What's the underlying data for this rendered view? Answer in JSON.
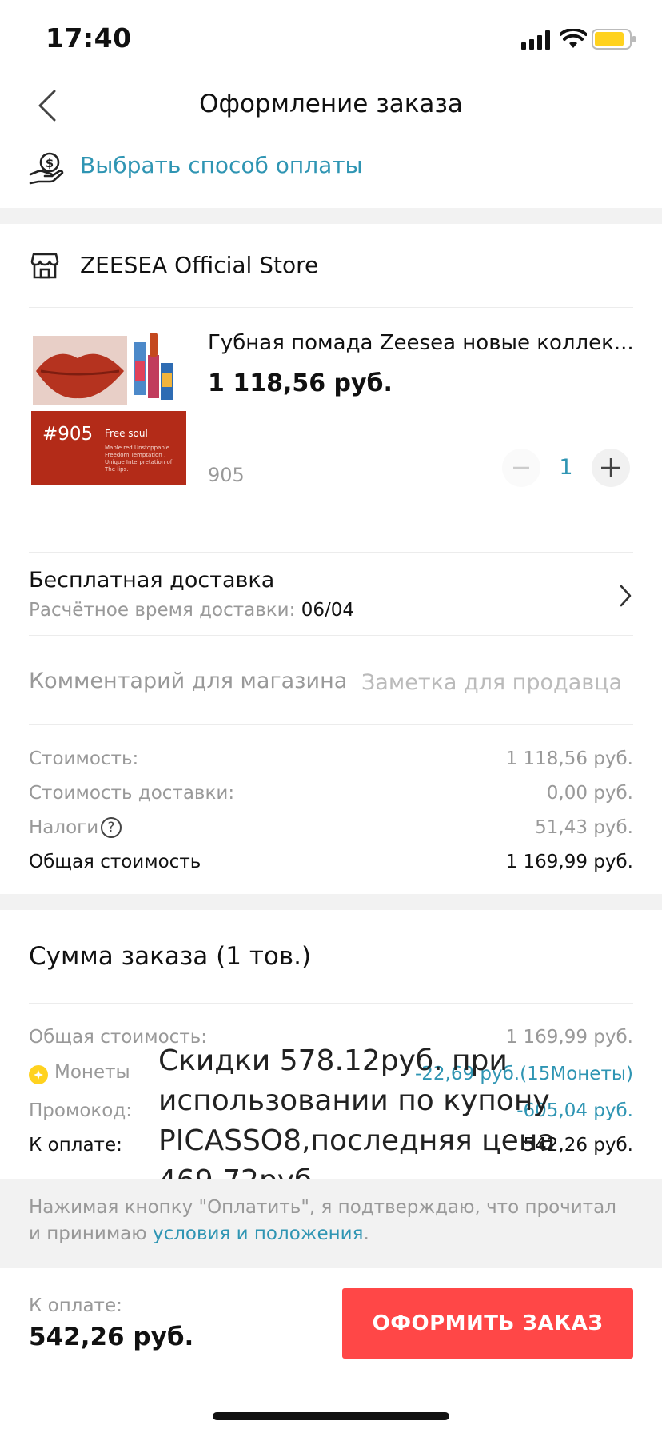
{
  "status_bar": {
    "time": "17:40"
  },
  "header": {
    "title": "Оформление заказа",
    "back_icon": "chevron-left-icon"
  },
  "payment": {
    "label": "Выбрать способ оплаты",
    "icon": "hand-coin-icon"
  },
  "store": {
    "name": "ZEESEA Official Store",
    "icon": "store-icon"
  },
  "product": {
    "title": "Губная помада Zeesea новые коллек...",
    "price": "1 118,56 руб.",
    "variant": "905",
    "quantity": "1",
    "image": {
      "shade_code": "#905",
      "shade_name": "Free soul",
      "description_lines": [
        "Maple red Unstoppable",
        "Freedom Temptation ,",
        "Unique Interpretation of",
        "The lips."
      ]
    }
  },
  "shipping": {
    "title": "Бесплатная доставка",
    "eta_label": "Расчётное время доставки:",
    "eta_value": "06/04"
  },
  "comment": {
    "label": "Комментарий для магазина",
    "placeholder": "Заметка для продавца",
    "value": ""
  },
  "store_summary": {
    "cost_label": "Стоимость:",
    "cost_value": "1 118,56 руб.",
    "shipping_label": "Стоимость доставки:",
    "shipping_value": "0,00 руб.",
    "tax_label": "Налоги",
    "tax_value": "51,43 руб.",
    "total_label": "Общая стоимость",
    "total_value": "1 169,99 руб."
  },
  "order_summary": {
    "title": "Сумма заказа (1 тов.)",
    "total_label": "Общая стоимость:",
    "total_value": "1 169,99 руб.",
    "coins_label": "Монеты",
    "coins_value": "-22,69 руб.(15Монеты)",
    "promo_label": "Промокод:",
    "promo_value": "-605,04 руб.",
    "pay_label": "К оплате:",
    "pay_value": "542,26 руб."
  },
  "overlay_note": "Скидки 578.12руб. при использовании по купону PICASSO8,последняя цена 469.72руб.",
  "terms": {
    "text_before": "Нажимая кнопку \"Оплатить\", я подтверждаю, что прочитал и принимаю ",
    "link": "условия и положения",
    "text_after": "."
  },
  "footer": {
    "pay_label": "К оплате:",
    "pay_value": "542,26 руб.",
    "cta_label": "ОФОРМИТЬ ЗАКАЗ"
  },
  "colors": {
    "accent_blue": "#2f95b3",
    "cta_red": "#ff4747",
    "coin_yellow": "#ffd21f",
    "battery_yellow": "#ffd21f"
  }
}
